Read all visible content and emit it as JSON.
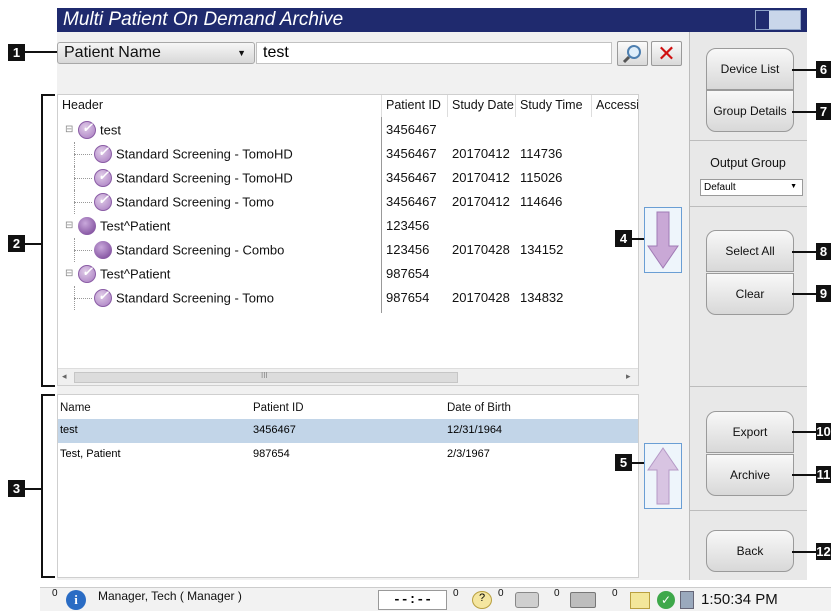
{
  "title": "Multi Patient On Demand Archive",
  "search": {
    "field": "Patient Name",
    "value": "test"
  },
  "callouts": [
    "1",
    "2",
    "3",
    "4",
    "5",
    "6",
    "7",
    "8",
    "9",
    "10",
    "11",
    "12"
  ],
  "tree": {
    "columns": [
      "Header",
      "Patient ID",
      "Study Date",
      "Study Time",
      "Accessi"
    ],
    "rows": [
      {
        "label": "test",
        "pid": "3456467",
        "date": "",
        "time": "",
        "icon": "check"
      },
      {
        "label": "Standard Screening - TomoHD",
        "pid": "3456467",
        "date": "20170412",
        "time": "114736",
        "icon": "check"
      },
      {
        "label": "Standard Screening - TomoHD",
        "pid": "3456467",
        "date": "20170412",
        "time": "115026",
        "icon": "check"
      },
      {
        "label": "Standard Screening - Tomo",
        "pid": "3456467",
        "date": "20170412",
        "time": "114646",
        "icon": "check"
      },
      {
        "label": "Test^Patient",
        "pid": "123456",
        "date": "",
        "time": "",
        "icon": "dot"
      },
      {
        "label": "Standard Screening - Combo",
        "pid": "123456",
        "date": "20170428",
        "time": "134152",
        "icon": "dot"
      },
      {
        "label": "Test^Patient",
        "pid": "987654",
        "date": "",
        "time": "",
        "icon": "check"
      },
      {
        "label": "Standard Screening - Tomo",
        "pid": "987654",
        "date": "20170428",
        "time": "134832",
        "icon": "check"
      }
    ],
    "scroll_mark": "III"
  },
  "patients": {
    "columns": [
      "Name",
      "Patient ID",
      "Date of Birth"
    ],
    "rows": [
      {
        "name": "test",
        "pid": "3456467",
        "dob": "12/31/1964",
        "selected": true
      },
      {
        "name": "Test, Patient",
        "pid": "987654",
        "dob": "2/3/1967",
        "selected": false
      }
    ]
  },
  "buttons": {
    "device_list": "Device List",
    "group_details": "Group Details",
    "output_group_label": "Output Group",
    "output_group_value": "Default",
    "select_all": "Select All",
    "clear": "Clear",
    "export": "Export",
    "archive": "Archive",
    "back": "Back"
  },
  "status": {
    "user": "Manager, Tech ( Manager )",
    "timer": "--:--",
    "count0": "0",
    "count1": "0",
    "count2": "0",
    "count3": "0",
    "count4": "0",
    "count5": "0",
    "clock": "1:50:34 PM"
  },
  "colors": {
    "titlebar": "#1f2a6e",
    "selected_row": "#c2d5e8",
    "accent_purple": "#a77ac0"
  }
}
